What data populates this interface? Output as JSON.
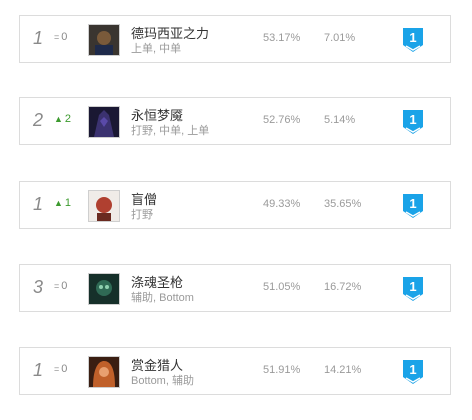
{
  "champions": [
    {
      "rank": "1",
      "change": "0",
      "change_dir": "same",
      "name": "德玛西亚之力",
      "roles": "上单, 中单",
      "win_rate": "53.17%",
      "pick_rate": "7.01%",
      "tier": "1",
      "portrait_colors": [
        "#3a3530",
        "#7a5a3a",
        "#1e2a4a"
      ]
    },
    {
      "rank": "2",
      "change": "2",
      "change_dir": "up",
      "name": "永恒梦魇",
      "roles": "打野, 中单, 上单",
      "win_rate": "52.76%",
      "pick_rate": "5.14%",
      "tier": "1",
      "portrait_colors": [
        "#1a1833",
        "#3b3270",
        "#5a4aa8"
      ]
    },
    {
      "rank": "1",
      "change": "1",
      "change_dir": "up",
      "name": "盲僧",
      "roles": "打野",
      "win_rate": "49.33%",
      "pick_rate": "35.65%",
      "tier": "1",
      "portrait_colors": [
        "#f0ece8",
        "#b04030",
        "#6a2a20"
      ]
    },
    {
      "rank": "3",
      "change": "0",
      "change_dir": "same",
      "name": "涤魂圣枪",
      "roles": "辅助, Bottom",
      "win_rate": "51.05%",
      "pick_rate": "16.72%",
      "tier": "1",
      "portrait_colors": [
        "#16302a",
        "#2f6a55",
        "#8fd0b0"
      ]
    },
    {
      "rank": "1",
      "change": "0",
      "change_dir": "same",
      "name": "赏金猎人",
      "roles": "Bottom, 辅助",
      "win_rate": "51.91%",
      "pick_rate": "14.21%",
      "tier": "1",
      "portrait_colors": [
        "#3a1e12",
        "#c0602a",
        "#e8a070"
      ]
    }
  ],
  "colors": {
    "tier_badge": "#1aa3e8",
    "up_arrow": "#3c9a2e"
  },
  "icons": {
    "same": "equals-icon",
    "up": "arrow-up-icon",
    "tier": "tier-badge-icon"
  }
}
